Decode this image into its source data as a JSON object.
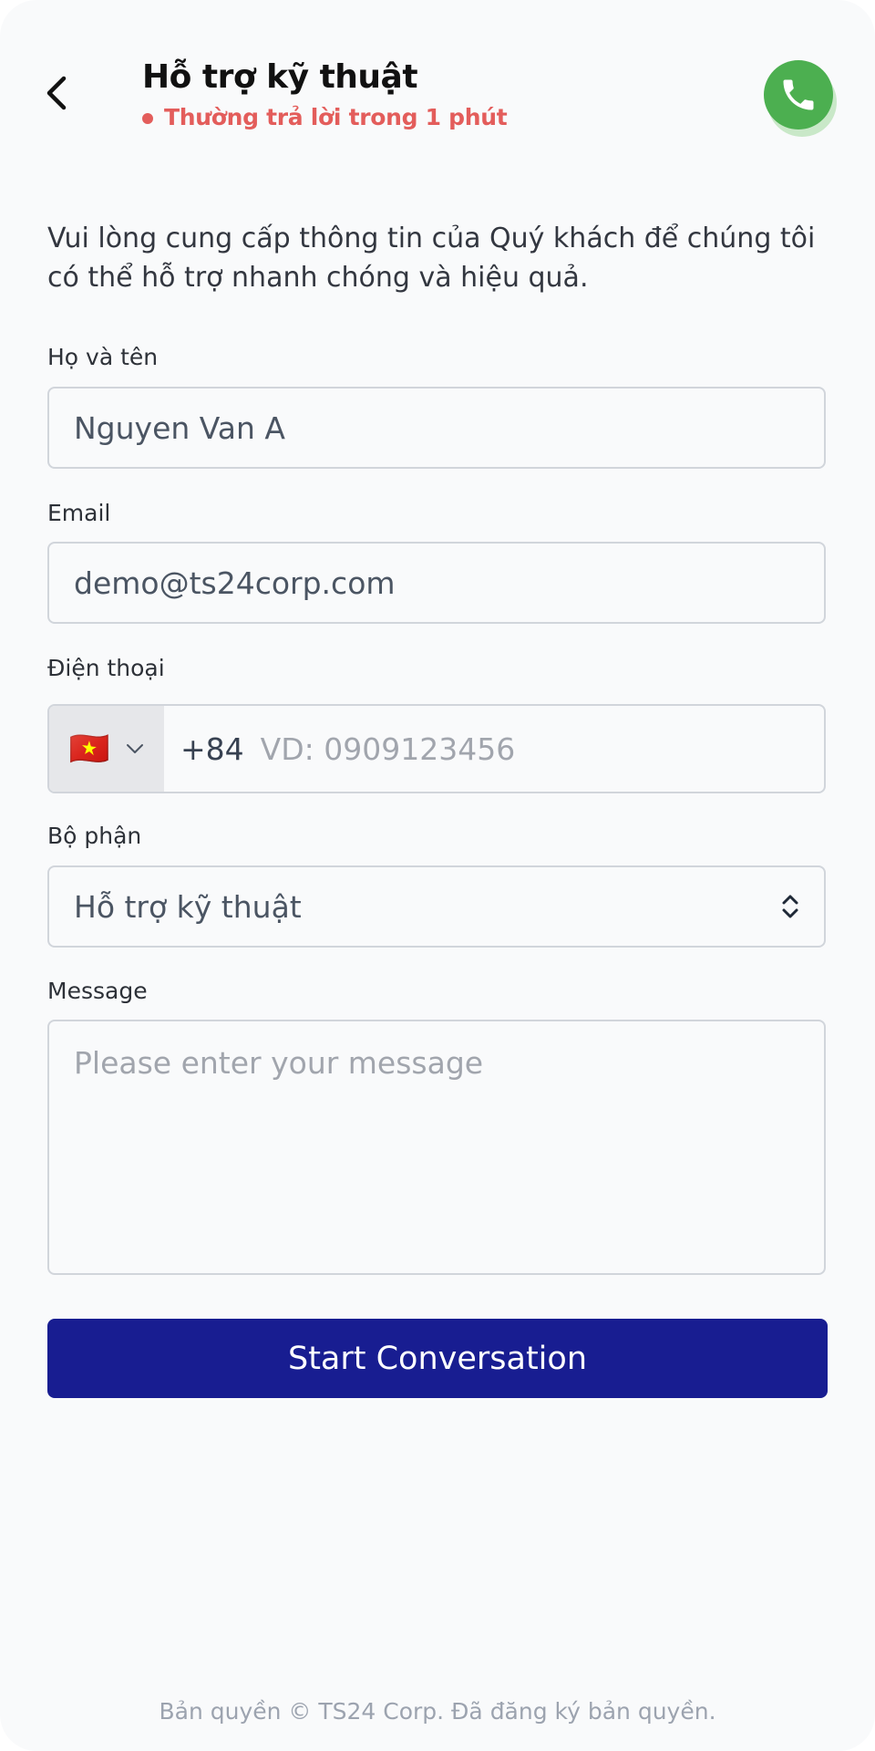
{
  "header": {
    "title": "Hỗ trợ kỹ thuật",
    "status": "Thường trả lời trong 1 phút",
    "status_color": "#e35d5b",
    "call_button_color": "#4caf50"
  },
  "intro": "Vui lòng cung cấp thông tin của Quý khách để chúng tôi có thể hỗ trợ nhanh chóng và hiệu quả.",
  "form": {
    "name": {
      "label": "Họ và tên",
      "value": "Nguyen Van A"
    },
    "email": {
      "label": "Email",
      "value": "demo@ts24corp.com"
    },
    "phone": {
      "label": "Điện thoại",
      "country_flag": "🇻🇳",
      "dial_code": "+84",
      "placeholder": "VD: 0909123456"
    },
    "department": {
      "label": "Bộ phận",
      "selected": "Hỗ trợ kỹ thuật"
    },
    "message": {
      "label": "Message",
      "placeholder": "Please enter your message"
    },
    "submit_label": "Start Conversation",
    "submit_color": "#181d91"
  },
  "footer": "Bản quyền © TS24 Corp. Đã đăng ký bản quyền."
}
